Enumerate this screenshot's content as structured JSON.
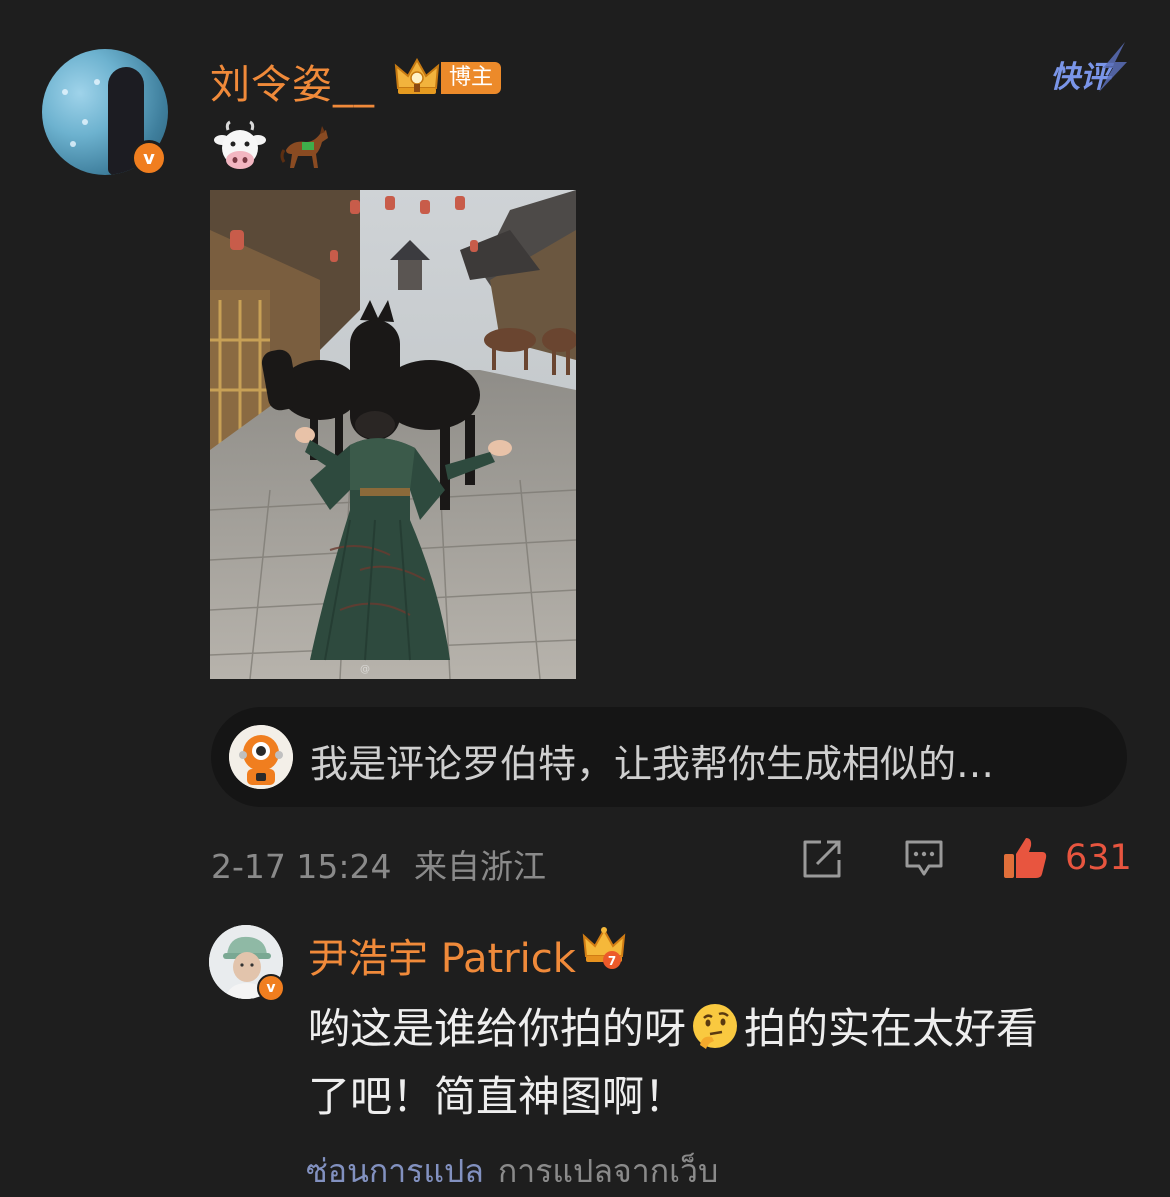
{
  "post": {
    "username": "刘令姿__",
    "badge_label": "博主",
    "kuaiping_label": "快评",
    "emojis": [
      "cow-face",
      "horse-racing"
    ],
    "ai_prompt": "我是评论罗伯特，让我帮你生成相似的…",
    "timestamp": "2-17 15:24",
    "location": "来自浙江",
    "like_count": "631",
    "colors": {
      "background": "#1e1e1e",
      "username": "#f08a3a",
      "badge": "#ec8a2a",
      "like": "#e8553f",
      "kuaiping": "#7a95e8"
    }
  },
  "reply": {
    "username": "尹浩宇 Patrick",
    "text_line1_part1": "哟这是谁给你拍的呀",
    "text_line1_emoji": "thinking-face",
    "text_line1_part2": "拍的实在太好看",
    "text_line2": "了吧！简直神图啊！",
    "hide_translation": "ซ่อนการแปล",
    "translation_source": "การแปลจากเว็บ"
  }
}
